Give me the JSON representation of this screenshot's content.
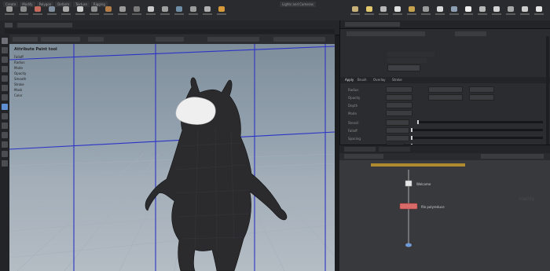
{
  "top_bar": {
    "tabs_left": [
      "Create",
      "Modify",
      "Polygon",
      "Deform",
      "Texture",
      "Rigging"
    ],
    "tabs_right": [
      "Lights and Cameras"
    ]
  },
  "viewport": {
    "tool_title": "Attribute Paint tool",
    "panel_items": [
      "Falloff",
      "Radius",
      "Mode",
      "Opacity",
      "Smooth",
      "Stroke",
      "Mask",
      "Color"
    ]
  },
  "right_panel": {
    "param_rows": [
      "Radius",
      "Opacity",
      "Depth",
      "Mode",
      "Stencil",
      "Falloff",
      "Spacing",
      "Ramp"
    ],
    "tabs": [
      "Apply",
      "Brush",
      "Overlay",
      "Stroke"
    ]
  },
  "node_editor": {
    "nodes": [
      {
        "label": "Welcome",
        "color": "#cfcfcf"
      },
      {
        "label": "file polyreduce",
        "color": "#d96a6a"
      }
    ],
    "watermark": "mainly"
  },
  "colors": {
    "grid_line": "#2b33c7",
    "accent_slider": "#d4d4d4"
  }
}
